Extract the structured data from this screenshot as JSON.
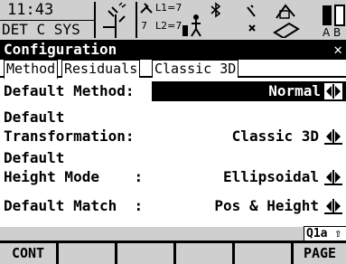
{
  "status": {
    "time": "11:43",
    "system_line": "DET C SYS",
    "satellites": {
      "l1_label": "L1=",
      "l1_count": "7",
      "l2_label": "L2=",
      "l2_count": "7",
      "rtk_count": "7"
    },
    "battery_labels": "A B"
  },
  "window": {
    "title": "Configuration",
    "close_symbol": "✕"
  },
  "tabs": [
    {
      "label": "Method"
    },
    {
      "label": "Residuals"
    },
    {
      "label": "Classic 3D"
    }
  ],
  "fields": [
    {
      "label": "Default Method:",
      "value": "Normal"
    },
    {
      "label_line1": "Default",
      "label_line2": "Transformation:",
      "value": "Classic 3D"
    },
    {
      "label_line1": "Default",
      "label_line2": "Height Mode    :",
      "value": "Ellipsoidal"
    },
    {
      "label": "Default Match  :",
      "value": "Pos & Height"
    }
  ],
  "page_indicator": "Q1a ⇧",
  "softkeys": [
    "CONT",
    "",
    "",
    "",
    "",
    "PAGE"
  ],
  "icons": {
    "satellite": "satellite-icon",
    "bluetooth": "bluetooth-icon",
    "rover": "rover-icon",
    "radio": "radio-icon",
    "memory_card": "memory-card-icon",
    "battery": "battery-icon",
    "selector_arrow": "left-right-selector-icon"
  }
}
